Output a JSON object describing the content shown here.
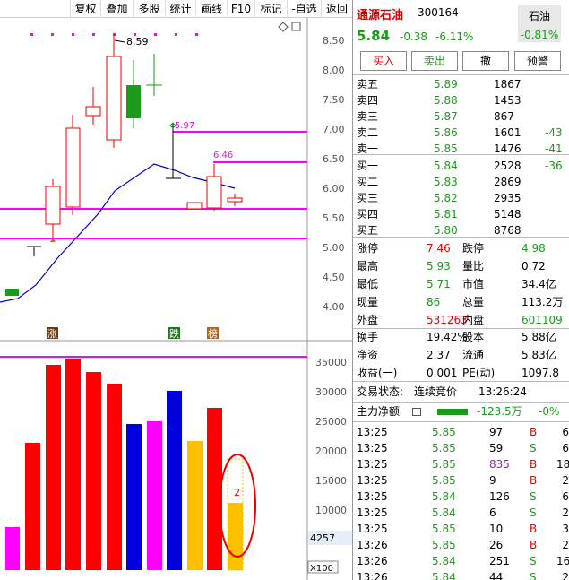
{
  "toolbar": {
    "items": [
      "复权",
      "叠加",
      "多股",
      "统计",
      "画线",
      "F10",
      "标记",
      "-自选",
      "返回"
    ]
  },
  "y_axis_price": [
    "8.50",
    "8.00",
    "7.50",
    "7.00",
    "6.50",
    "6.00",
    "5.50",
    "5.00",
    "4.50",
    "4.00"
  ],
  "y_axis_volume": [
    "35000",
    "30000",
    "25000",
    "20000",
    "15000",
    "10000"
  ],
  "volume_cursor_value": "4257",
  "volume_scale_label": "X100",
  "chart_annotations": {
    "high_label": "8.59",
    "mid_label": "5.97",
    "low_label": "6.46",
    "vol_bar_label": "2"
  },
  "event_markers": [
    "涨",
    "跌",
    "榜"
  ],
  "quote": {
    "name": "通源石油",
    "code": "300164",
    "sector": "石油",
    "sector_change": "-0.81%",
    "price": "5.84",
    "change": "-0.38",
    "change_pct": "-6.11%"
  },
  "buttons": {
    "buy": "买入",
    "sell": "卖出",
    "cancel": "撤",
    "alert": "预警"
  },
  "asks": [
    {
      "label": "卖五",
      "price": "5.89",
      "vol": "1867",
      "delta": ""
    },
    {
      "label": "卖四",
      "price": "5.88",
      "vol": "1453",
      "delta": ""
    },
    {
      "label": "卖三",
      "price": "5.87",
      "vol": "867",
      "delta": ""
    },
    {
      "label": "卖二",
      "price": "5.86",
      "vol": "1601",
      "delta": "-43"
    },
    {
      "label": "卖一",
      "price": "5.85",
      "vol": "1476",
      "delta": "-41"
    }
  ],
  "bids": [
    {
      "label": "买一",
      "price": "5.84",
      "vol": "2528",
      "delta": "-36"
    },
    {
      "label": "买二",
      "price": "5.83",
      "vol": "2869",
      "delta": ""
    },
    {
      "label": "买三",
      "price": "5.82",
      "vol": "2935",
      "delta": ""
    },
    {
      "label": "买四",
      "price": "5.81",
      "vol": "5148",
      "delta": ""
    },
    {
      "label": "买五",
      "price": "5.80",
      "vol": "8768",
      "delta": ""
    }
  ],
  "stats1": [
    {
      "l1": "涨停",
      "v1": "7.46",
      "l2": "跌停",
      "v2": "4.98"
    },
    {
      "l1": "最高",
      "v1": "5.93",
      "l2": "量比",
      "v2": "0.72"
    },
    {
      "l1": "最低",
      "v1": "5.71",
      "l2": "市值",
      "v2": "34.4亿"
    },
    {
      "l1": "现量",
      "v1": "86",
      "l2": "总量",
      "v2": "113.2万"
    },
    {
      "l1": "外盘",
      "v1": "531263",
      "l2": "内盘",
      "v2": "601109"
    }
  ],
  "stats2": [
    {
      "l1": "换手",
      "v1": "19.42%",
      "l2": "股本",
      "v2": "5.88亿"
    },
    {
      "l1": "净资",
      "v1": "2.37",
      "l2": "流通",
      "v2": "5.83亿"
    },
    {
      "l1": "收益(一)",
      "v1": "0.001",
      "l2": "PE(动)",
      "v2": "1097.8"
    }
  ],
  "trade_status": {
    "label": "交易状态:",
    "value": "连续竞价",
    "time": "13:26:24"
  },
  "main_flow": {
    "label": "主力净额",
    "value": "-123.5万",
    "pct": "-0%"
  },
  "ticks": [
    {
      "t": "13:25",
      "p": "5.85",
      "v": "97",
      "s": "B",
      "n": "6"
    },
    {
      "t": "13:25",
      "p": "5.85",
      "v": "59",
      "s": "S",
      "n": "6"
    },
    {
      "t": "13:25",
      "p": "5.85",
      "v": "835",
      "s": "B",
      "n": "18"
    },
    {
      "t": "13:25",
      "p": "5.85",
      "v": "9",
      "s": "B",
      "n": "2"
    },
    {
      "t": "13:25",
      "p": "5.84",
      "v": "126",
      "s": "S",
      "n": "6"
    },
    {
      "t": "13:25",
      "p": "5.84",
      "v": "6",
      "s": "S",
      "n": "2"
    },
    {
      "t": "13:25",
      "p": "5.85",
      "v": "10",
      "s": "B",
      "n": "3"
    },
    {
      "t": "13:26",
      "p": "5.85",
      "v": "26",
      "s": "B",
      "n": "2"
    },
    {
      "t": "13:26",
      "p": "5.84",
      "v": "251",
      "s": "S",
      "n": "16"
    },
    {
      "t": "13:26",
      "p": "5.84",
      "v": "44",
      "s": "S",
      "n": "2"
    }
  ],
  "colors": {
    "up": "#e00000",
    "down": "#1a9b1a",
    "magenta": "#ff00ff",
    "blue": "#0000cc",
    "yellow": "#ffc000"
  }
}
